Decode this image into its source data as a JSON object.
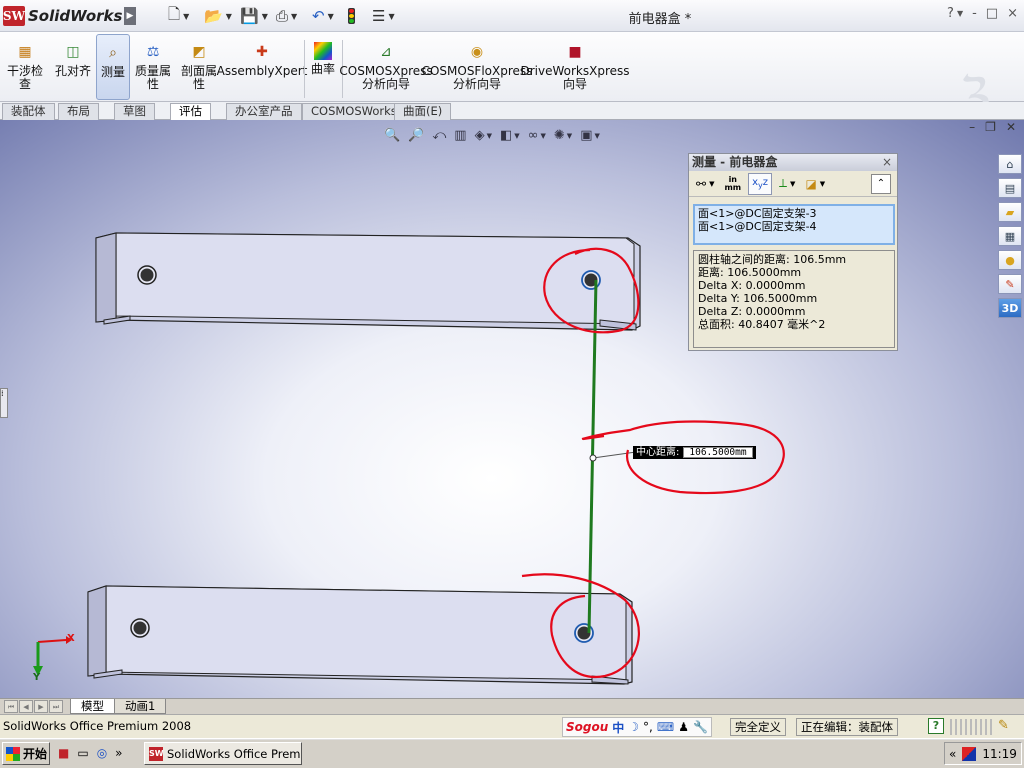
{
  "app": {
    "brand": "SolidWorks",
    "doc_title": "前电器盒 *",
    "window_controls": [
      "?",
      "-",
      "□",
      "×"
    ]
  },
  "commands": [
    {
      "label": "干涉检\n查",
      "icon": "interference-check-icon"
    },
    {
      "label": "孔对齐",
      "icon": "hole-alignment-icon"
    },
    {
      "label": "测量",
      "icon": "measure-icon",
      "active": true
    },
    {
      "label": "质量属\n性",
      "icon": "mass-properties-icon"
    },
    {
      "label": "剖面属\n性",
      "icon": "section-properties-icon"
    },
    {
      "label": "AssemblyXpert",
      "icon": "assemblyxpert-icon"
    },
    {
      "label": "曲率",
      "icon": "curvature-icon"
    },
    {
      "label": "COSMOSXpress\n分析向导",
      "icon": "cosmosxpress-icon"
    },
    {
      "label": "COSMOSFloXpress\n分析向导",
      "icon": "cosmosfloxpress-icon"
    },
    {
      "label": "DriveWorksXpress\n向导",
      "icon": "driveworksxpress-icon"
    }
  ],
  "tabs": [
    "装配体",
    "布局",
    "草图",
    "评估",
    "办公室产品",
    "COSMOSWorks",
    "曲面(E)"
  ],
  "active_tab": "评估",
  "measure_dialog": {
    "title": "测量 - 前电器盒",
    "close": "×",
    "units_label_top": "in",
    "units_label_bottom": "mm",
    "selections": [
      "面<1>@DC固定支架-3",
      "面<1>@DC固定支架-4"
    ],
    "results": [
      "圆柱轴之间的距离: 106.5mm",
      "距离: 106.5000mm",
      "Delta X: 0.0000mm",
      "Delta Y: 106.5000mm",
      "Delta Z: 0.0000mm",
      "总面积: 40.8407 毫米^2"
    ]
  },
  "callout": {
    "label": "中心距离:",
    "value": "106.5000mm"
  },
  "triad": {
    "x": "X",
    "y": "Y"
  },
  "model_tabs": [
    "模型",
    "动画1"
  ],
  "active_model_tab": "模型",
  "status": {
    "left": "SolidWorks Office Premium 2008",
    "ime_brand": "Sogou",
    "ime_lang": "中",
    "definition": "完全定义",
    "editing": "正在编辑：装配体"
  },
  "taskbar": {
    "start": "开始",
    "task_label": "SolidWorks Office Premiu...",
    "clock": "11:19",
    "tray_arrow": "«"
  },
  "colors": {
    "measure_line": "#1f7a1f",
    "annotation": "#e5091b",
    "part_fill": "#d9dbee"
  }
}
